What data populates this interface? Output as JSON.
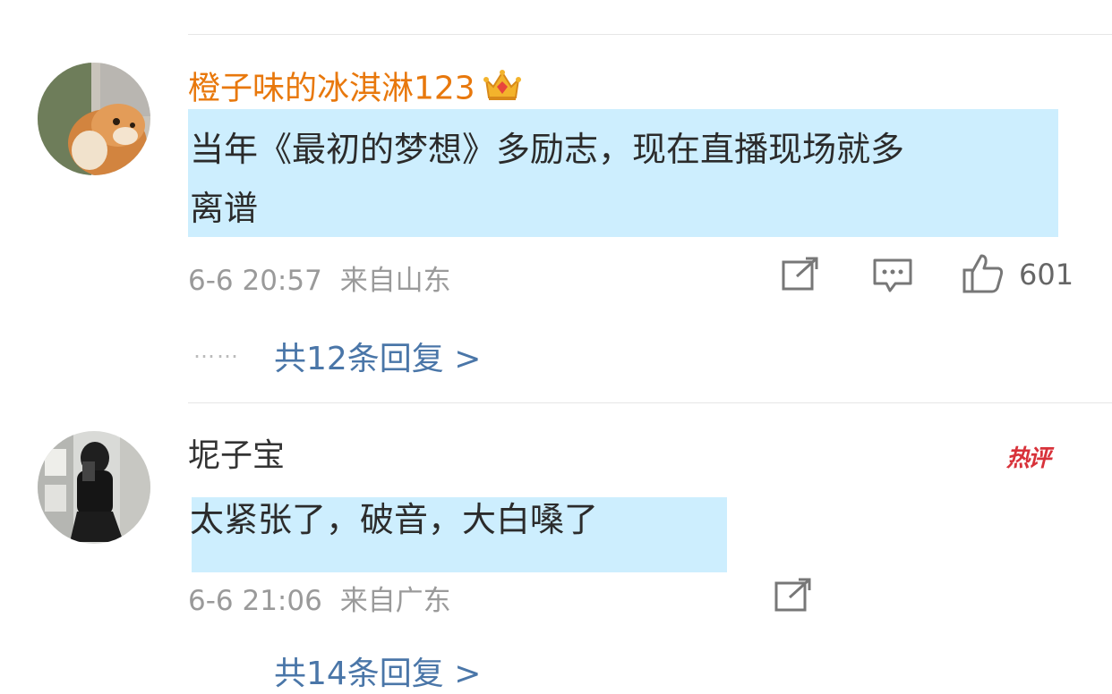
{
  "comments": [
    {
      "username": "橙子味的冰淇淋123",
      "text_line1": "当年《最初的梦想》多励志，现在直播现场就多",
      "text_line2": "离谱",
      "time": "6-6 20:57",
      "location": "来自山东",
      "likes": "601",
      "replies_label": "共12条回复 >",
      "dots": "……"
    },
    {
      "username": "坭子宝",
      "badge": "热评",
      "text_line1": "太紧张了，破音，大白嗓了",
      "time": "6-6 21:06",
      "location": "来自广东",
      "replies_label": "共14条回复 >"
    }
  ],
  "colors": {
    "highlight": "#cdeefe",
    "username_vip": "#e8780c",
    "reply_link": "#4a76a8",
    "hot_badge": "#d8323a"
  }
}
